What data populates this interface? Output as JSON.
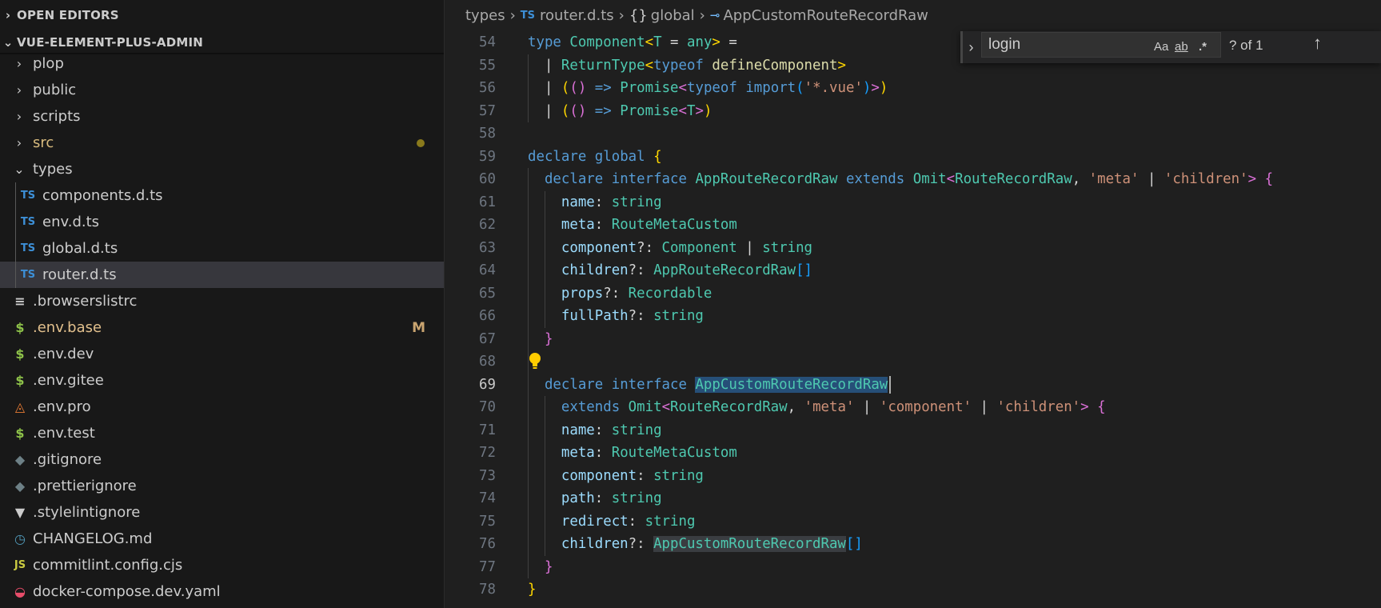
{
  "sidebar": {
    "open_editors": "OPEN EDITORS",
    "project": "VUE-ELEMENT-PLUS-ADMIN",
    "items": [
      {
        "name": "plop",
        "kind": "folder",
        "expanded": false
      },
      {
        "name": "public",
        "kind": "folder",
        "expanded": false
      },
      {
        "name": "scripts",
        "kind": "folder",
        "expanded": false
      },
      {
        "name": "src",
        "kind": "folder",
        "expanded": false,
        "modified_dot": true
      },
      {
        "name": "types",
        "kind": "folder",
        "expanded": true
      },
      {
        "name": "components.d.ts",
        "kind": "ts",
        "icon_text": "TS"
      },
      {
        "name": "env.d.ts",
        "kind": "ts",
        "icon_text": "TS"
      },
      {
        "name": "global.d.ts",
        "kind": "ts",
        "icon_text": "TS"
      },
      {
        "name": "router.d.ts",
        "kind": "ts",
        "icon_text": "TS",
        "selected": true
      },
      {
        "name": ".browserslistrc",
        "kind": "lines-icon"
      },
      {
        "name": ".env.base",
        "kind": "dollar-icon",
        "status": "M"
      },
      {
        "name": ".env.dev",
        "kind": "dollar-icon"
      },
      {
        "name": ".env.gitee",
        "kind": "dollar-icon"
      },
      {
        "name": ".env.pro",
        "kind": "fox-icon"
      },
      {
        "name": ".env.test",
        "kind": "dollar-icon"
      },
      {
        "name": ".gitignore",
        "kind": "git-icon"
      },
      {
        "name": ".prettierignore",
        "kind": "git-icon"
      },
      {
        "name": ".stylelintignore",
        "kind": "stylelint-icon"
      },
      {
        "name": "CHANGELOG.md",
        "kind": "clock-icon"
      },
      {
        "name": "commitlint.config.cjs",
        "kind": "js",
        "icon_text": "JS"
      },
      {
        "name": "docker-compose.dev.yaml",
        "kind": "docker-icon"
      }
    ]
  },
  "breadcrumb": {
    "folder": "types",
    "file_icon": "TS",
    "file": "router.d.ts",
    "namespace_icon": "{}",
    "namespace": "global",
    "symbol": "AppCustomRouteRecordRaw"
  },
  "find": {
    "value": "login",
    "match_case": "Aa",
    "whole_word": "ab",
    "regex": ".*",
    "count": "? of 1"
  },
  "code": {
    "active_line": 69,
    "lines": [
      {
        "n": "54"
      },
      {
        "n": "55"
      },
      {
        "n": "56"
      },
      {
        "n": "57"
      },
      {
        "n": "58"
      },
      {
        "n": "59"
      },
      {
        "n": "60"
      },
      {
        "n": "61"
      },
      {
        "n": "62"
      },
      {
        "n": "63"
      },
      {
        "n": "64"
      },
      {
        "n": "65"
      },
      {
        "n": "66"
      },
      {
        "n": "67"
      },
      {
        "n": "68"
      },
      {
        "n": "69"
      },
      {
        "n": "70"
      },
      {
        "n": "71"
      },
      {
        "n": "72"
      },
      {
        "n": "73"
      },
      {
        "n": "74"
      },
      {
        "n": "75"
      },
      {
        "n": "76"
      },
      {
        "n": "77"
      },
      {
        "n": "78"
      }
    ],
    "tokens": {
      "54": [
        [
          "type",
          "k"
        ],
        [
          " ",
          "p"
        ],
        [
          "Component",
          "t"
        ],
        [
          "<",
          "b1"
        ],
        [
          "T",
          "t"
        ],
        [
          " = ",
          "p"
        ],
        [
          "any",
          "t"
        ],
        [
          ">",
          "b1"
        ],
        [
          " =",
          "p"
        ]
      ],
      "55": [
        [
          "  | ",
          "p"
        ],
        [
          "ReturnType",
          "t"
        ],
        [
          "<",
          "b1"
        ],
        [
          "typeof",
          "k"
        ],
        [
          " ",
          "p"
        ],
        [
          "defineComponent",
          "f"
        ],
        [
          ">",
          "b1"
        ]
      ],
      "56": [
        [
          "  | ",
          "p"
        ],
        [
          "(",
          "b1"
        ],
        [
          "()",
          "b2"
        ],
        [
          " => ",
          "k"
        ],
        [
          "Promise",
          "t"
        ],
        [
          "<",
          "b2"
        ],
        [
          "typeof",
          "k"
        ],
        [
          " ",
          "p"
        ],
        [
          "import",
          "k"
        ],
        [
          "(",
          "b3"
        ],
        [
          "'*.vue'",
          "s"
        ],
        [
          ")",
          "b3"
        ],
        [
          ">",
          "b2"
        ],
        [
          ")",
          "b1"
        ]
      ],
      "57": [
        [
          "  | ",
          "p"
        ],
        [
          "(",
          "b1"
        ],
        [
          "()",
          "b2"
        ],
        [
          " => ",
          "k"
        ],
        [
          "Promise",
          "t"
        ],
        [
          "<",
          "b2"
        ],
        [
          "T",
          "t"
        ],
        [
          ">",
          "b2"
        ],
        [
          ")",
          "b1"
        ]
      ],
      "58": [],
      "59": [
        [
          "declare",
          "k"
        ],
        [
          " ",
          "p"
        ],
        [
          "global",
          "k"
        ],
        [
          " ",
          "p"
        ],
        [
          "{",
          "b1"
        ]
      ],
      "60": [
        [
          "  ",
          "p"
        ],
        [
          "declare",
          "k"
        ],
        [
          " ",
          "p"
        ],
        [
          "interface",
          "k"
        ],
        [
          " ",
          "p"
        ],
        [
          "AppRouteRecordRaw",
          "t"
        ],
        [
          " ",
          "p"
        ],
        [
          "extends",
          "k"
        ],
        [
          " ",
          "p"
        ],
        [
          "Omit",
          "t"
        ],
        [
          "<",
          "b2"
        ],
        [
          "RouteRecordRaw",
          "t"
        ],
        [
          ", ",
          "p"
        ],
        [
          "'meta'",
          "s"
        ],
        [
          " | ",
          "p"
        ],
        [
          "'children'",
          "s"
        ],
        [
          ">",
          "b2"
        ],
        [
          " ",
          "p"
        ],
        [
          "{",
          "b2"
        ]
      ],
      "61": [
        [
          "    ",
          "p"
        ],
        [
          "name",
          "v"
        ],
        [
          ": ",
          "p"
        ],
        [
          "string",
          "t"
        ]
      ],
      "62": [
        [
          "    ",
          "p"
        ],
        [
          "meta",
          "v"
        ],
        [
          ": ",
          "p"
        ],
        [
          "RouteMetaCustom",
          "t"
        ]
      ],
      "63": [
        [
          "    ",
          "p"
        ],
        [
          "component",
          "v"
        ],
        [
          "?: ",
          "p"
        ],
        [
          "Component",
          "t"
        ],
        [
          " | ",
          "p"
        ],
        [
          "string",
          "t"
        ]
      ],
      "64": [
        [
          "    ",
          "p"
        ],
        [
          "children",
          "v"
        ],
        [
          "?: ",
          "p"
        ],
        [
          "AppRouteRecordRaw",
          "t"
        ],
        [
          "[]",
          "b3"
        ]
      ],
      "65": [
        [
          "    ",
          "p"
        ],
        [
          "props",
          "v"
        ],
        [
          "?: ",
          "p"
        ],
        [
          "Recordable",
          "t"
        ]
      ],
      "66": [
        [
          "    ",
          "p"
        ],
        [
          "fullPath",
          "v"
        ],
        [
          "?: ",
          "p"
        ],
        [
          "string",
          "t"
        ]
      ],
      "67": [
        [
          "  ",
          "p"
        ],
        [
          "}",
          "b2"
        ]
      ],
      "68": [],
      "69": [
        [
          "  ",
          "p"
        ],
        [
          "declare",
          "k"
        ],
        [
          " ",
          "p"
        ],
        [
          "interface",
          "k"
        ],
        [
          " ",
          "p"
        ],
        [
          "AppCustomRouteRecordRaw",
          "t sel"
        ]
      ],
      "70": [
        [
          "    ",
          "p"
        ],
        [
          "extends",
          "k"
        ],
        [
          " ",
          "p"
        ],
        [
          "Omit",
          "t"
        ],
        [
          "<",
          "b2"
        ],
        [
          "RouteRecordRaw",
          "t"
        ],
        [
          ", ",
          "p"
        ],
        [
          "'meta'",
          "s"
        ],
        [
          " | ",
          "p"
        ],
        [
          "'component'",
          "s"
        ],
        [
          " | ",
          "p"
        ],
        [
          "'children'",
          "s"
        ],
        [
          ">",
          "b2"
        ],
        [
          " ",
          "p"
        ],
        [
          "{",
          "b2"
        ]
      ],
      "71": [
        [
          "    ",
          "p"
        ],
        [
          "name",
          "v"
        ],
        [
          ": ",
          "p"
        ],
        [
          "string",
          "t"
        ]
      ],
      "72": [
        [
          "    ",
          "p"
        ],
        [
          "meta",
          "v"
        ],
        [
          ": ",
          "p"
        ],
        [
          "RouteMetaCustom",
          "t"
        ]
      ],
      "73": [
        [
          "    ",
          "p"
        ],
        [
          "component",
          "v"
        ],
        [
          ": ",
          "p"
        ],
        [
          "string",
          "t"
        ]
      ],
      "74": [
        [
          "    ",
          "p"
        ],
        [
          "path",
          "v"
        ],
        [
          ": ",
          "p"
        ],
        [
          "string",
          "t"
        ]
      ],
      "75": [
        [
          "    ",
          "p"
        ],
        [
          "redirect",
          "v"
        ],
        [
          ": ",
          "p"
        ],
        [
          "string",
          "t"
        ]
      ],
      "76": [
        [
          "    ",
          "p"
        ],
        [
          "children",
          "v"
        ],
        [
          "?: ",
          "p"
        ],
        [
          "AppCustomRouteRecordRaw",
          "t hl"
        ],
        [
          "[]",
          "b3"
        ]
      ],
      "77": [
        [
          "  ",
          "p"
        ],
        [
          "}",
          "b2"
        ]
      ],
      "78": [
        [
          "}",
          "b1"
        ]
      ]
    }
  }
}
